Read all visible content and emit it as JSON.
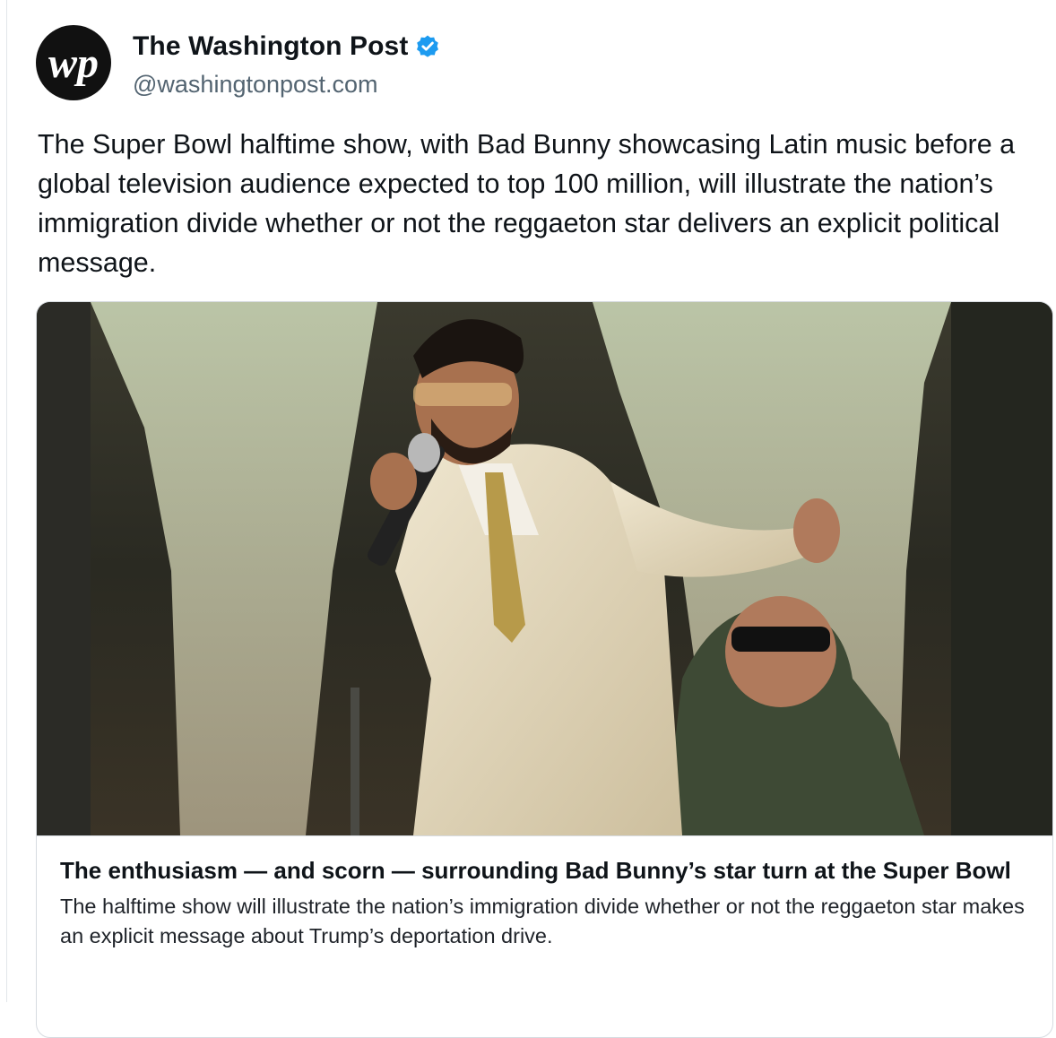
{
  "post": {
    "account": {
      "display_name": "The Washington Post",
      "handle": "@washingtonpost.com",
      "avatar_monogram": "wp",
      "verified_icon": "verified-badge-icon"
    },
    "text": "The Super Bowl halftime show, with Bad Bunny showcasing Latin music before a global television audience expected to top 100 million, will illustrate the nation’s immigration divide whether or not the reggaeton star delivers an explicit political message."
  },
  "link_card": {
    "image": "photo-bad-bunny-performing",
    "title": "The enthusiasm — and scorn — surrounding Bad Bunny’s star turn at the Super Bowl",
    "description": "The halftime show will illustrate the nation’s immigration divide whether or not the reggaeton star makes an explicit message about Trump’s deportation drive."
  },
  "colors": {
    "verified_blue": "#1d9bf0",
    "handle_gray": "#536471",
    "text": "#0f1419",
    "card_border": "#d6dbe0"
  }
}
